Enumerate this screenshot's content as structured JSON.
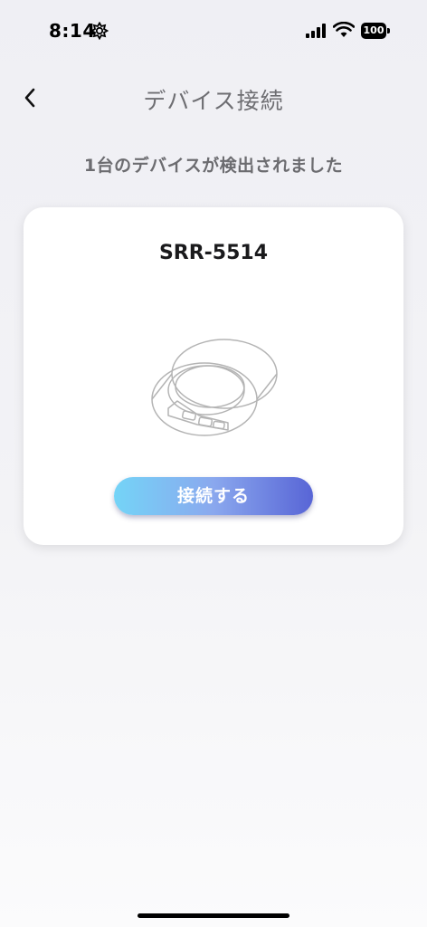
{
  "status_bar": {
    "time": "8:14",
    "battery_level": "100",
    "icons": [
      "focus-icon",
      "signal-icon",
      "wifi-icon",
      "battery-icon"
    ]
  },
  "header": {
    "back_icon": "chevron-left-icon",
    "title": "デバイス接続"
  },
  "main": {
    "subtitle": "1台のデバイスが検出されました",
    "device_card": {
      "name": "SRR-5514",
      "image_icon": "smart-ring-image",
      "connect_label": "接続する"
    }
  },
  "colors": {
    "button_gradient_start": "#74d4f7",
    "button_gradient_end": "#5865d6",
    "title_gray": "#6e6e72"
  }
}
